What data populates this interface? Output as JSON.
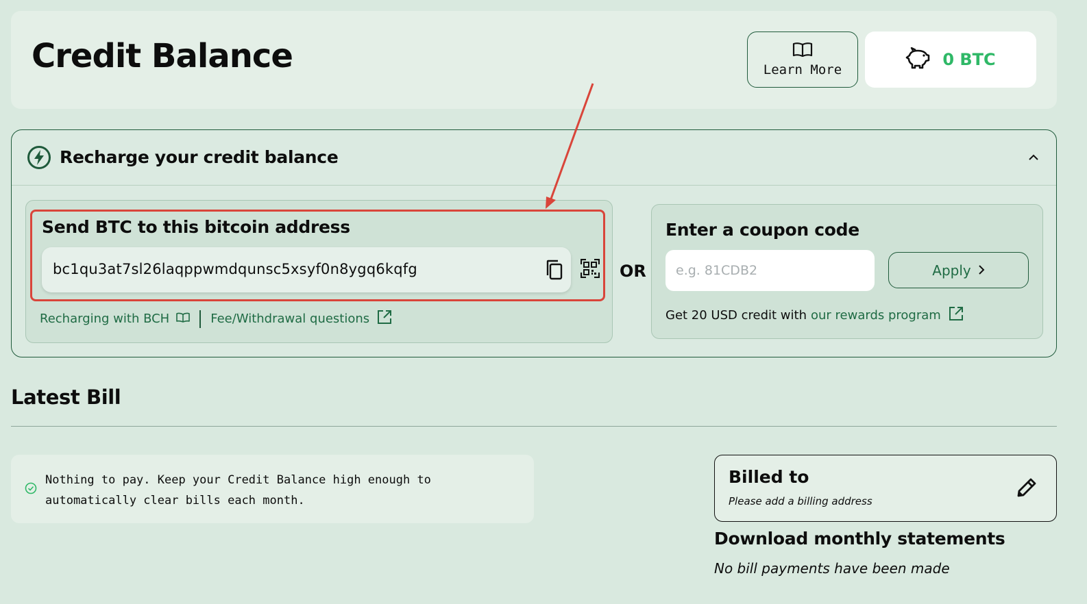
{
  "header": {
    "title": "Credit Balance",
    "learn_more_label": "Learn More",
    "balance_value": "0 BTC"
  },
  "recharge": {
    "title": "Recharge your credit balance",
    "btc": {
      "title": "Send BTC to this bitcoin address",
      "address": "bc1qu3at7sl26laqppwmdqunsc5xsyf0n8ygq6kqfg",
      "link_bch": "Recharging with BCH",
      "link_fee": "Fee/Withdrawal questions"
    },
    "or_label": "OR",
    "coupon": {
      "title": "Enter a coupon code",
      "placeholder": "e.g. 81CDB2",
      "apply_label": "Apply",
      "reward_prefix": "Get 20 USD credit with",
      "reward_link": "our rewards program"
    }
  },
  "bill": {
    "section_title": "Latest Bill",
    "status_text": "Nothing to pay. Keep your Credit Balance high enough to automatically clear bills each month.",
    "billed_to_title": "Billed to",
    "billed_to_sub": "Please add a billing address",
    "statements_title": "Download monthly statements",
    "statements_sub": "No bill payments have been made"
  },
  "colors": {
    "background": "#d9e9df",
    "accent_green": "#1f6b44",
    "balance_green": "#2fb867",
    "highlight_red": "#d9453a"
  }
}
